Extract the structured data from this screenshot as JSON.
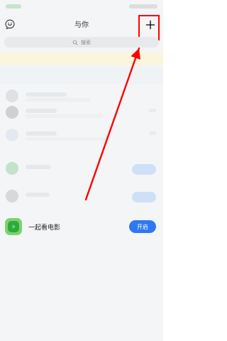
{
  "header": {
    "title": "与你"
  },
  "search": {
    "placeholder": "搜索"
  },
  "feature_row": {
    "title": "一起看电影",
    "button_label": "开启"
  },
  "colors": {
    "accent_blue": "#2f78f2",
    "highlight_red": "#ff0000",
    "app_icon_green": "#2da944"
  },
  "icons": {
    "assistant": "assistant-icon",
    "plus": "plus-icon",
    "search": "search-icon",
    "play": "play-icon"
  }
}
